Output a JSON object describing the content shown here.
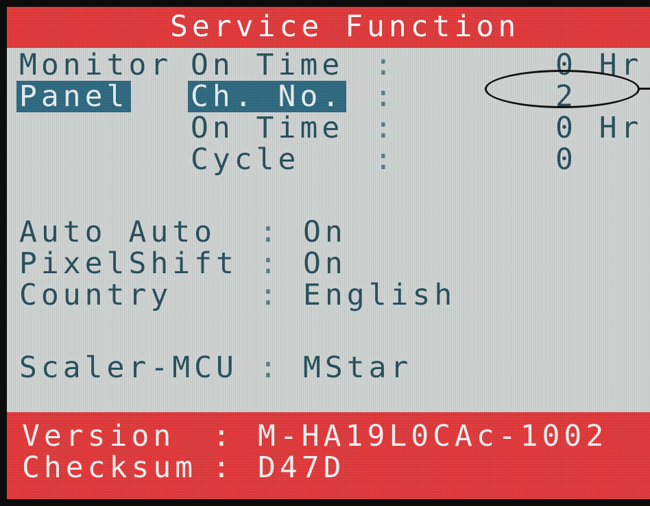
{
  "header": {
    "title": "Service Function"
  },
  "monitor": {
    "label": "Monitor",
    "on_time_label": "On Time",
    "on_time_value": "0 Hr"
  },
  "panel": {
    "label": "Panel",
    "channel_label": "Ch. No.",
    "channel_value": "2",
    "on_time_label": "On Time",
    "on_time_value": "0 Hr",
    "cycle_label": "Cycle",
    "cycle_value": "0"
  },
  "separator": ":",
  "settings": [
    {
      "label": "Auto Auto",
      "value": "On"
    },
    {
      "label": "PixelShift",
      "value": "On"
    },
    {
      "label": "Country",
      "value": "English"
    }
  ],
  "scaler": {
    "label": "Scaler-MCU",
    "value": "MStar"
  },
  "footer": {
    "version_label": "Version",
    "version_value": "M-HA19L0CAc-1002",
    "checksum_label": "Checksum",
    "checksum_value": "D47D"
  },
  "colors": {
    "header_red": "#e13a3c",
    "body_gray": "#cfd4d3",
    "text_teal": "#27505c",
    "highlight": "#2f6a81"
  }
}
